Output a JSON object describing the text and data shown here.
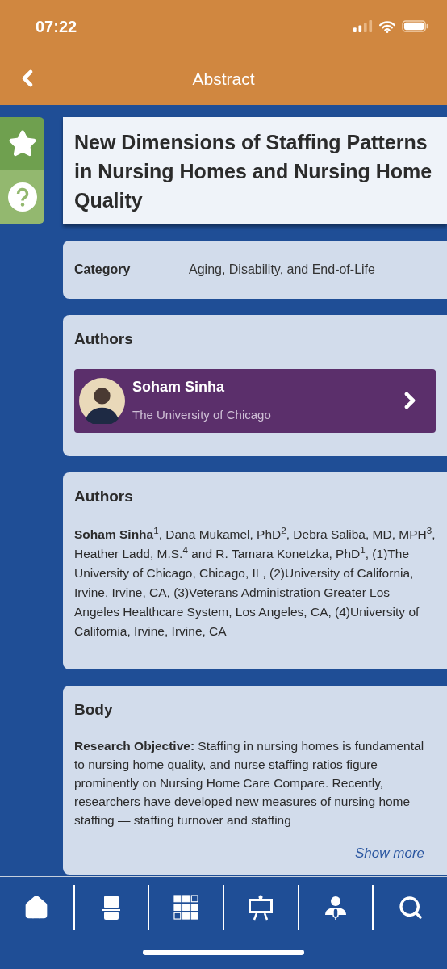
{
  "status_bar": {
    "time": "07:22"
  },
  "header": {
    "title": "Abstract"
  },
  "side_tabs": [
    {
      "kind": "star"
    },
    {
      "kind": "help"
    }
  ],
  "abstract": {
    "title": "New Dimensions of Staffing Patterns in Nursing Homes and Nursing Home Quality"
  },
  "category": {
    "label": "Category",
    "value": "Aging, Disability, and End-of-Life"
  },
  "presenter": {
    "heading": "Authors",
    "name": "Soham Sinha",
    "affiliation": "The University of Chicago"
  },
  "authors": {
    "heading": "Authors",
    "text": "**Soham Sinha**$^{1}$, Dana Mukamel, PhD$^{2}$, Debra Saliba, MD, MPH$^{3}$, Heather Ladd, M.S.$^{4}$ and R. Tamara Konetzka, PhD$^{1}$, (1)The University of Chicago, Chicago, IL, (2)University of California, Irvine, Irvine, CA, (3)Veterans Administration Greater Los Angeles Healthcare System, Los Angeles, CA, (4)University of California, Irvine, Irvine, CA"
  },
  "body": {
    "heading": "Body",
    "text": "**Research Objective:** Staffing in nursing homes is fundamental to nursing home quality, and nurse staffing ratios figure prominently on Nursing Home Care Compare. Recently, researchers have developed new measures of nursing home staffing — staffing turnover and staffing",
    "more": "Show more"
  },
  "tab_bar": [
    {
      "kind": "home"
    },
    {
      "kind": "booth"
    },
    {
      "kind": "floorplan"
    },
    {
      "kind": "easel"
    },
    {
      "kind": "speaker"
    },
    {
      "kind": "search"
    }
  ]
}
